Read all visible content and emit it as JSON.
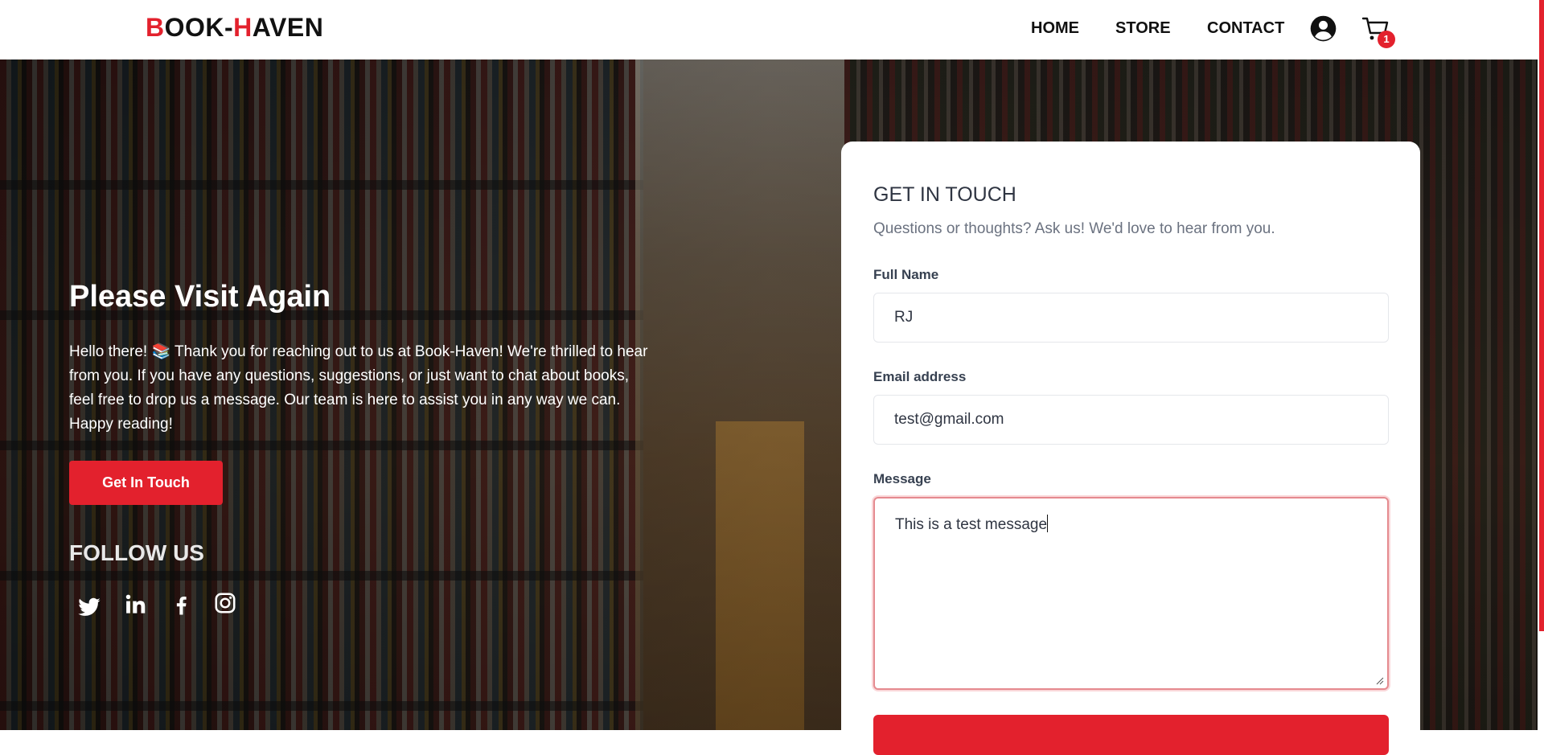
{
  "header": {
    "logo": {
      "part1_initial": "B",
      "part1_rest": "OOK-",
      "part2_initial": "H",
      "part2_rest": "AVEN"
    },
    "nav": [
      {
        "label": "HOME"
      },
      {
        "label": "STORE"
      },
      {
        "label": "CONTACT"
      }
    ],
    "cart_count": "1",
    "icons": {
      "account": "user-circle-icon",
      "cart": "shopping-cart-icon"
    }
  },
  "hero": {
    "title": "Please Visit Again",
    "text": "Hello there! 📚 Thank you for reaching out to us at Book-Haven! We're thrilled to hear from you. If you have any questions, suggestions, or just want to chat about books, feel free to drop us a message. Our team is here to assist you in any way we can. Happy reading!",
    "cta_label": "Get In Touch",
    "follow_title": "FOLLOW US",
    "social_icons": [
      "twitter-icon",
      "linkedin-icon",
      "facebook-icon",
      "instagram-icon"
    ]
  },
  "contact_form": {
    "title": "GET IN TOUCH",
    "subtitle": "Questions or thoughts? Ask us! We'd love to hear from you.",
    "full_name": {
      "label": "Full Name",
      "value": "RJ"
    },
    "email": {
      "label": "Email address",
      "value": "test@gmail.com"
    },
    "message": {
      "label": "Message",
      "value": "This is a test message"
    }
  },
  "colors": {
    "brand_red": "#e3212d",
    "text_dark": "#111111",
    "card_title": "#2f3542",
    "muted": "#6b7280"
  }
}
